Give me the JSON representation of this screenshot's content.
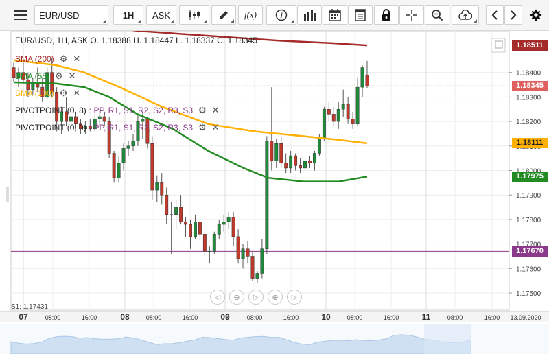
{
  "toolbar": {
    "menu_icon": "hamburger-icon",
    "symbol": "EUR/USD",
    "timeframe": "1H",
    "price_type": "ASK",
    "chart_type_icon": "candles-icon",
    "draw_icon": "pencil-icon",
    "indicator_label": "f(x)",
    "info_icon": "info-icon",
    "volume_icon": "bars-icon",
    "calendar_icon": "calendar-icon",
    "news_icon": "news-icon",
    "lock_icon": "lock-icon",
    "crosshair_icon": "crosshair-icon",
    "zoom_icon": "zoom-icon",
    "cloud_icon": "cloud-upload-icon",
    "prev_icon": "chevron-left-icon",
    "next_icon": "chevron-right-icon",
    "settings_icon": "gear-icon"
  },
  "header": {
    "ohlc": "EUR/USD, 1H, ASK   O. 1.18388 H. 1.18447 L. 1.18337 C. 1.18345"
  },
  "indicators": [
    {
      "label": "SMA (200)",
      "color": "#a52a2a"
    },
    {
      "label": "SMA (55)",
      "color": "#228b22"
    },
    {
      "label": "SMA (100)",
      "color": "#ffb000"
    }
  ],
  "pivots": [
    {
      "label": "PIVOTPOINT (0, 8)",
      "tail": ": PP, R1, S1, R2, S2, R3, S3"
    },
    {
      "label": "PIVOTPOINT (0, 9)",
      "tail": ": PP, R1, S1, R2, S2, R3, S3"
    }
  ],
  "s1_label": "S1: 1.17431",
  "nav_buttons": [
    "◁",
    "⊖",
    "▷",
    "⊕",
    "▷"
  ],
  "chart_data": {
    "type": "candlestick",
    "price_levels": [
      "1.18400",
      "1.18300",
      "1.18200",
      "1.18100",
      "1.18000",
      "1.17900",
      "1.17800",
      "1.17700",
      "1.17600",
      "1.17500"
    ],
    "price_tags": [
      {
        "value": "1.18511",
        "series": "SMA (200)",
        "bg": "#a52a2a",
        "fg": "#ffffff"
      },
      {
        "value": "1.18345",
        "series": "Last price",
        "bg": "#e06060",
        "fg": "#ffffff"
      },
      {
        "value": "1.18111",
        "series": "SMA (100)",
        "bg": "#ffb000",
        "fg": "#222222"
      },
      {
        "value": "1.17975",
        "series": "SMA (55)",
        "bg": "#228b22",
        "fg": "#ffffff"
      },
      {
        "value": "1.17670",
        "series": "Pivot",
        "bg": "#8b3a8b",
        "fg": "#ffffff"
      }
    ],
    "last_price": 1.18345,
    "pivot_level": 1.1767,
    "x_ticks": [
      {
        "label": "07",
        "bold": true
      },
      {
        "label": "08:00",
        "bold": false
      },
      {
        "label": "16:00",
        "bold": false
      },
      {
        "label": "08",
        "bold": true
      },
      {
        "label": "08:00",
        "bold": false
      },
      {
        "label": "16:00",
        "bold": false
      },
      {
        "label": "09",
        "bold": true
      },
      {
        "label": "08:00",
        "bold": false
      },
      {
        "label": "16:00",
        "bold": false
      },
      {
        "label": "10",
        "bold": true
      },
      {
        "label": "08:00",
        "bold": false
      },
      {
        "label": "16:00",
        "bold": false
      },
      {
        "label": "11",
        "bold": true
      },
      {
        "label": "08:00",
        "bold": false
      },
      {
        "label": "16:00",
        "bold": false
      },
      {
        "label": "13.09.2020",
        "bold": false
      }
    ],
    "y_min": 1.1743,
    "y_max": 1.1857,
    "candles": [
      [
        1.1842,
        1.1844,
        1.1836,
        1.1838
      ],
      [
        1.1838,
        1.1842,
        1.1834,
        1.184
      ],
      [
        1.184,
        1.1844,
        1.1836,
        1.1837
      ],
      [
        1.1837,
        1.184,
        1.183,
        1.1833
      ],
      [
        1.1833,
        1.1838,
        1.1831,
        1.1836
      ],
      [
        1.1836,
        1.1842,
        1.1832,
        1.1834
      ],
      [
        1.1834,
        1.1838,
        1.1828,
        1.183
      ],
      [
        1.183,
        1.1842,
        1.1829,
        1.184
      ],
      [
        1.184,
        1.1846,
        1.183,
        1.1832
      ],
      [
        1.1832,
        1.1834,
        1.1816,
        1.182
      ],
      [
        1.182,
        1.1826,
        1.1815,
        1.1824
      ],
      [
        1.1824,
        1.183,
        1.1818,
        1.182
      ],
      [
        1.182,
        1.1826,
        1.1814,
        1.1822
      ],
      [
        1.1822,
        1.1824,
        1.1817,
        1.1819
      ],
      [
        1.1819,
        1.1821,
        1.1815,
        1.1817
      ],
      [
        1.1817,
        1.182,
        1.1815,
        1.1818
      ],
      [
        1.1818,
        1.1821,
        1.1816,
        1.1817
      ],
      [
        1.1817,
        1.1823,
        1.1816,
        1.1821
      ],
      [
        1.1821,
        1.1825,
        1.1818,
        1.1822
      ],
      [
        1.1822,
        1.1824,
        1.1818,
        1.182
      ],
      [
        1.182,
        1.1822,
        1.1805,
        1.1807
      ],
      [
        1.1807,
        1.1808,
        1.1795,
        1.1797
      ],
      [
        1.1797,
        1.1806,
        1.1795,
        1.1803
      ],
      [
        1.1803,
        1.1811,
        1.18,
        1.1809
      ],
      [
        1.1809,
        1.1812,
        1.1806,
        1.181
      ],
      [
        1.181,
        1.1815,
        1.1808,
        1.1812
      ],
      [
        1.1812,
        1.1823,
        1.181,
        1.182
      ],
      [
        1.182,
        1.1824,
        1.1813,
        1.1821
      ],
      [
        1.1821,
        1.1822,
        1.1809,
        1.1811
      ],
      [
        1.1811,
        1.1814,
        1.1788,
        1.1792
      ],
      [
        1.1792,
        1.1798,
        1.1787,
        1.1795
      ],
      [
        1.1795,
        1.1799,
        1.1786,
        1.179
      ],
      [
        1.179,
        1.1793,
        1.1778,
        1.1782
      ],
      [
        1.1782,
        1.1787,
        1.1766,
        1.1782
      ],
      [
        1.1782,
        1.1788,
        1.1776,
        1.1785
      ],
      [
        1.1785,
        1.179,
        1.1778,
        1.1779
      ],
      [
        1.1779,
        1.1781,
        1.1773,
        1.1778
      ],
      [
        1.1778,
        1.178,
        1.1768,
        1.1773
      ],
      [
        1.1773,
        1.1782,
        1.1772,
        1.1779
      ],
      [
        1.1779,
        1.178,
        1.1771,
        1.1774
      ],
      [
        1.1774,
        1.1775,
        1.1765,
        1.1767
      ],
      [
        1.1767,
        1.1769,
        1.1762,
        1.1767
      ],
      [
        1.1767,
        1.1775,
        1.1766,
        1.1774
      ],
      [
        1.1774,
        1.178,
        1.1772,
        1.1778
      ],
      [
        1.1778,
        1.1782,
        1.1775,
        1.1779
      ],
      [
        1.1779,
        1.1783,
        1.1776,
        1.1781
      ],
      [
        1.1781,
        1.1783,
        1.1769,
        1.1773
      ],
      [
        1.1773,
        1.1776,
        1.1762,
        1.1764
      ],
      [
        1.1764,
        1.177,
        1.176,
        1.1768
      ],
      [
        1.1768,
        1.1771,
        1.1762,
        1.1765
      ],
      [
        1.1765,
        1.1767,
        1.1755,
        1.1756
      ],
      [
        1.1756,
        1.1759,
        1.1754,
        1.1758
      ],
      [
        1.1758,
        1.1772,
        1.1756,
        1.1768
      ],
      [
        1.1768,
        1.1814,
        1.1766,
        1.1812
      ],
      [
        1.1812,
        1.1834,
        1.18,
        1.1804
      ],
      [
        1.1804,
        1.1813,
        1.1801,
        1.1811
      ],
      [
        1.1811,
        1.1814,
        1.1801,
        1.1803
      ],
      [
        1.1803,
        1.1807,
        1.1799,
        1.1801
      ],
      [
        1.1801,
        1.1808,
        1.1799,
        1.1806
      ],
      [
        1.1806,
        1.1807,
        1.18,
        1.1802
      ],
      [
        1.1802,
        1.1805,
        1.1799,
        1.1801
      ],
      [
        1.1801,
        1.1806,
        1.1799,
        1.1804
      ],
      [
        1.1804,
        1.1806,
        1.1801,
        1.1803
      ],
      [
        1.1803,
        1.1808,
        1.18,
        1.1807
      ],
      [
        1.1807,
        1.1815,
        1.1806,
        1.1813
      ],
      [
        1.1813,
        1.1826,
        1.1812,
        1.1825
      ],
      [
        1.1825,
        1.1828,
        1.182,
        1.1823
      ],
      [
        1.1823,
        1.1826,
        1.1818,
        1.182
      ],
      [
        1.182,
        1.1828,
        1.1817,
        1.1825
      ],
      [
        1.1825,
        1.1833,
        1.1822,
        1.1827
      ],
      [
        1.1827,
        1.183,
        1.1819,
        1.1821
      ],
      [
        1.1821,
        1.1824,
        1.1817,
        1.1819
      ],
      [
        1.1819,
        1.1838,
        1.1818,
        1.1834
      ],
      [
        1.1834,
        1.1843,
        1.183,
        1.1842
      ],
      [
        1.18388,
        1.18447,
        1.18337,
        1.18345
      ]
    ],
    "sma200": [
      [
        0,
        1.1871
      ],
      [
        0.15,
        1.1861
      ],
      [
        0.35,
        1.1857
      ],
      [
        0.55,
        1.1855
      ],
      [
        0.75,
        1.1853
      ],
      [
        0.9,
        1.1852
      ],
      [
        1,
        1.18511
      ]
    ],
    "sma100": [
      [
        0,
        1.1845
      ],
      [
        0.12,
        1.1843
      ],
      [
        0.2,
        1.184
      ],
      [
        0.3,
        1.1834
      ],
      [
        0.42,
        1.1826
      ],
      [
        0.55,
        1.1819
      ],
      [
        0.68,
        1.1816
      ],
      [
        0.82,
        1.1814
      ],
      [
        0.92,
        1.18125
      ],
      [
        1,
        1.18111
      ]
    ],
    "sma55": [
      [
        0,
        1.1836
      ],
      [
        0.12,
        1.18355
      ],
      [
        0.2,
        1.1834
      ],
      [
        0.27,
        1.183
      ],
      [
        0.35,
        1.1823
      ],
      [
        0.45,
        1.1817
      ],
      [
        0.55,
        1.1808
      ],
      [
        0.65,
        1.1801
      ],
      [
        0.72,
        1.1797
      ],
      [
        0.82,
        1.17955
      ],
      [
        0.92,
        1.17955
      ],
      [
        1,
        1.17975
      ]
    ]
  }
}
